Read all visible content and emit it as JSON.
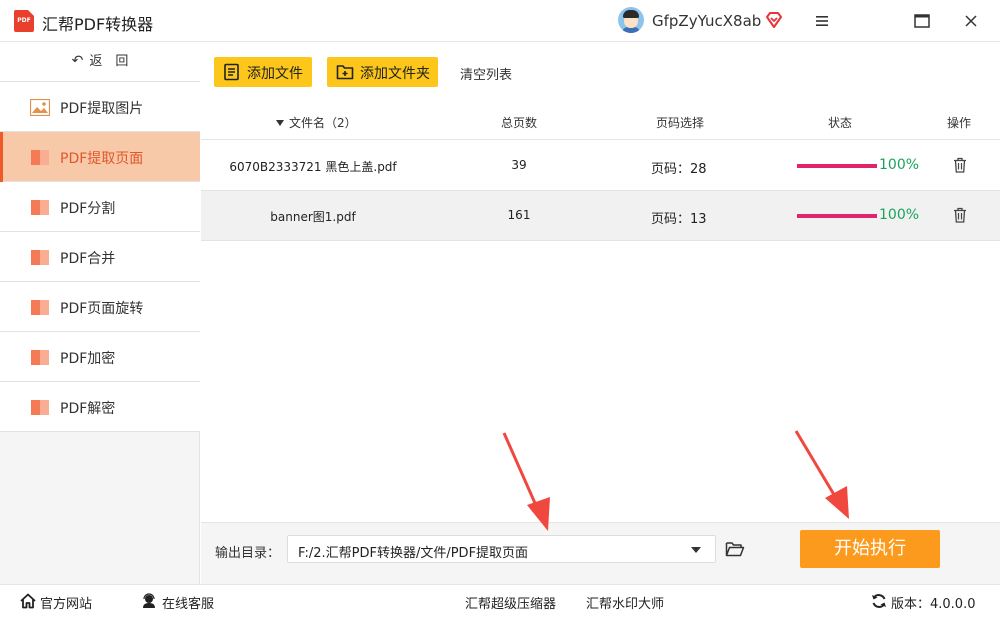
{
  "app": {
    "title": "汇帮PDF转换器",
    "logo_text": "PDF",
    "username": "GfpZyYucX8ab"
  },
  "sidebar": {
    "back_label": "返　回",
    "items": [
      {
        "label": "PDF提取图片",
        "icon": "image-icon"
      },
      {
        "label": "PDF提取页面",
        "icon": "pdf-page-icon"
      },
      {
        "label": "PDF分割",
        "icon": "pdf-page-icon"
      },
      {
        "label": "PDF合并",
        "icon": "pdf-page-icon"
      },
      {
        "label": "PDF页面旋转",
        "icon": "pdf-page-icon"
      },
      {
        "label": "PDF加密",
        "icon": "pdf-page-icon"
      },
      {
        "label": "PDF解密",
        "icon": "pdf-page-icon"
      }
    ],
    "active_index": 1
  },
  "toolbar": {
    "add_file": "添加文件",
    "add_folder": "添加文件夹",
    "clear_list": "清空列表"
  },
  "table": {
    "headers": {
      "name": "文件名（2）",
      "pages": "总页数",
      "range": "页码选择",
      "status": "状态",
      "action": "操作"
    },
    "rows": [
      {
        "name": "6070B2333721 黑色上盖.pdf",
        "pages": "39",
        "range": "页码：28",
        "progress": 100,
        "progress_text": "100%"
      },
      {
        "name": "banner图1.pdf",
        "pages": "161",
        "range": "页码：13",
        "progress": 100,
        "progress_text": "100%"
      }
    ]
  },
  "output": {
    "label": "输出目录：",
    "path": "F:/2.汇帮PDF转换器/文件/PDF提取页面",
    "start": "开始执行"
  },
  "footer": {
    "website": "官方网站",
    "support": "在线客服",
    "compressor": "汇帮超级压缩器",
    "watermark": "汇帮水印大师",
    "version": "版本：4.0.0.0"
  },
  "colors": {
    "accent": "#fcc61a",
    "start": "#fb9a1c",
    "active_nav": "#f8c9a9",
    "progress": "#e0256b",
    "percent": "#1aa35c",
    "arrow": "#f0473f"
  }
}
